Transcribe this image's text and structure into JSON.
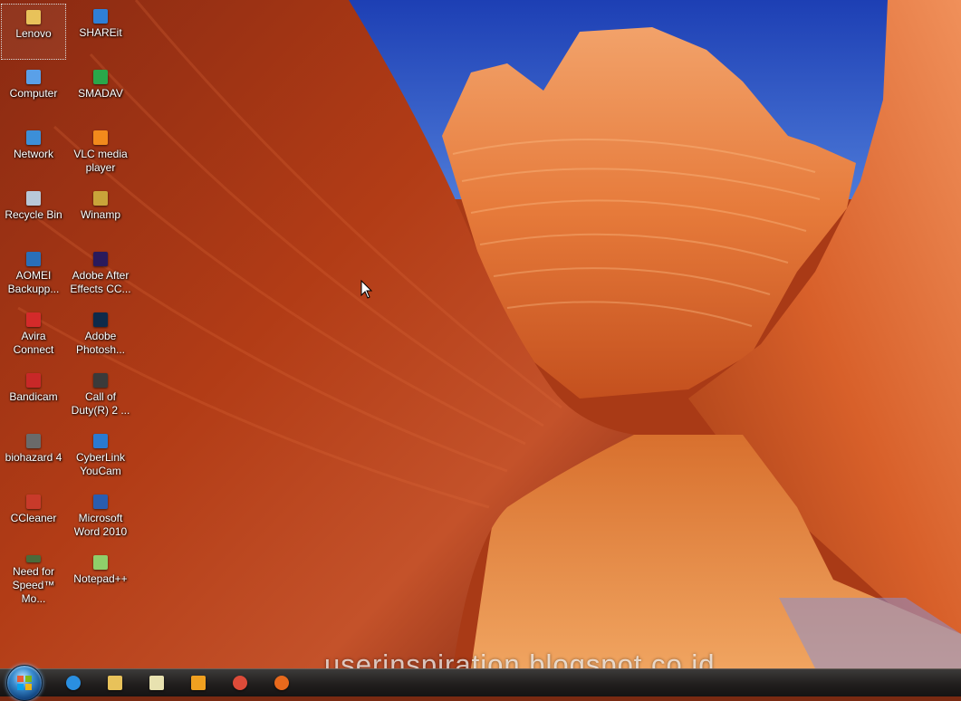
{
  "desktop": {
    "icons": [
      {
        "label": "Lenovo",
        "icon": "folder-icon",
        "color": "#e8c25a"
      },
      {
        "label": "SHAREit",
        "icon": "shareit-icon",
        "color": "#2f7fd6"
      },
      {
        "label": "Computer",
        "icon": "computer-icon",
        "color": "#5aa0e8"
      },
      {
        "label": "SMADAV",
        "icon": "smadav-icon",
        "color": "#2aa84a"
      },
      {
        "label": "Network",
        "icon": "network-icon",
        "color": "#3c8fd8"
      },
      {
        "label": "VLC media\nplayer",
        "icon": "vlc-icon",
        "color": "#f28a1c"
      },
      {
        "label": "Recycle Bin",
        "icon": "recycle-bin-icon",
        "color": "#b8c8d8"
      },
      {
        "label": "Winamp",
        "icon": "winamp-icon",
        "color": "#c9a43a"
      },
      {
        "label": "AOMEI\nBackupp...",
        "icon": "aomei-backupper-icon",
        "color": "#2a6fb8"
      },
      {
        "label": "Adobe After\nEffects CC...",
        "icon": "after-effects-icon",
        "color": "#2a1a5c"
      },
      {
        "label": "Avira\nConnect",
        "icon": "avira-icon",
        "color": "#d42a2a"
      },
      {
        "label": "Adobe\nPhotosh...",
        "icon": "photoshop-icon",
        "color": "#0e2a4a"
      },
      {
        "label": "Bandicam",
        "icon": "bandicam-icon",
        "color": "#c82828"
      },
      {
        "label": "Call of\nDuty(R) 2 ...",
        "icon": "call-of-duty-icon",
        "color": "#3a3a3a"
      },
      {
        "label": "biohazard 4",
        "icon": "biohazard-icon",
        "color": "#6a6a6a"
      },
      {
        "label": "CyberLink\nYouCam",
        "icon": "youcam-icon",
        "color": "#2a7ad2"
      },
      {
        "label": "CCleaner",
        "icon": "ccleaner-icon",
        "color": "#c83a2a"
      },
      {
        "label": "Microsoft\nWord 2010",
        "icon": "word-icon",
        "color": "#2a5db0"
      },
      {
        "label": "Need for\nSpeed™ Mo...",
        "icon": "need-for-speed-icon",
        "color": "#4a6a3a"
      },
      {
        "label": "Notepad++",
        "icon": "notepad-plus-plus-icon",
        "color": "#8fcf6a"
      }
    ]
  },
  "watermark": "userinspiration.blogspot.co.id",
  "taskbar": {
    "pinned": [
      {
        "icon": "internet-explorer-icon",
        "color": "#2a8fe0"
      },
      {
        "icon": "file-explorer-icon",
        "color": "#e8c25a"
      },
      {
        "icon": "notepad-icon",
        "color": "#e8e2b0"
      },
      {
        "icon": "media-player-icon",
        "color": "#f0a020"
      },
      {
        "icon": "chrome-icon",
        "color": "#dd4b39"
      },
      {
        "icon": "firefox-icon",
        "color": "#e8691c"
      }
    ]
  }
}
